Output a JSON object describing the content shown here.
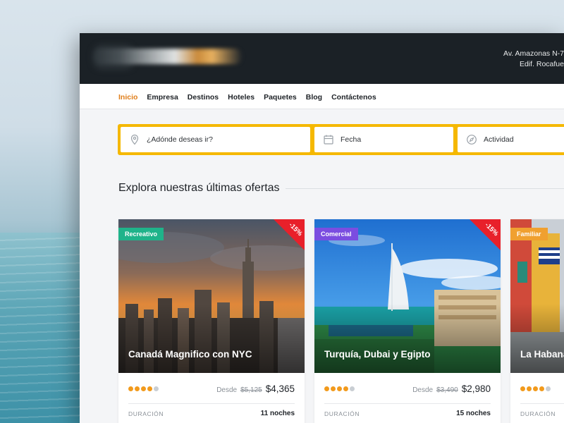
{
  "header": {
    "address_line1": "Av. Amazonas N-7",
    "address_line2": "Edif. Rocafue"
  },
  "nav": {
    "items": [
      {
        "label": "Inicio",
        "active": true
      },
      {
        "label": "Empresa",
        "active": false
      },
      {
        "label": "Destinos",
        "active": false
      },
      {
        "label": "Hoteles",
        "active": false
      },
      {
        "label": "Paquetes",
        "active": false
      },
      {
        "label": "Blog",
        "active": false
      },
      {
        "label": "Contáctenos",
        "active": false
      }
    ],
    "active_color": "#e07e1a"
  },
  "search": {
    "destination_placeholder": "¿Adónde deseas ir?",
    "destination_icon": "map-pin-icon",
    "date_placeholder": "Fecha",
    "date_icon": "calendar-icon",
    "activity_placeholder": "Actividad",
    "activity_icon": "compass-icon",
    "border_color": "#f5b800"
  },
  "offers": {
    "title": "Explora nuestras últimas ofertas",
    "cards": [
      {
        "category": "Recreativo",
        "category_color": "#1fb38a",
        "discount": "-15%",
        "title": "Canadá Magnifico con NYC",
        "rating": 4,
        "rating_max": 5,
        "from_label": "Desde",
        "old_price": "$5,125",
        "price": "$4,365",
        "duration_label": "DURACIÓN",
        "duration": "11 noches"
      },
      {
        "category": "Comercial",
        "category_color": "#7b4de0",
        "discount": "-15%",
        "title": "Turquía, Dubai y Egipto",
        "rating": 4,
        "rating_max": 5,
        "from_label": "Desde",
        "old_price": "$3,490",
        "price": "$2,980",
        "duration_label": "DURACIÓN",
        "duration": "15 noches"
      },
      {
        "category": "Familiar",
        "category_color": "#f0a030",
        "title": "La Habana",
        "rating": 4,
        "rating_max": 5,
        "duration_label": "DURACIÓN"
      }
    ],
    "discount_color": "#e8202a"
  }
}
